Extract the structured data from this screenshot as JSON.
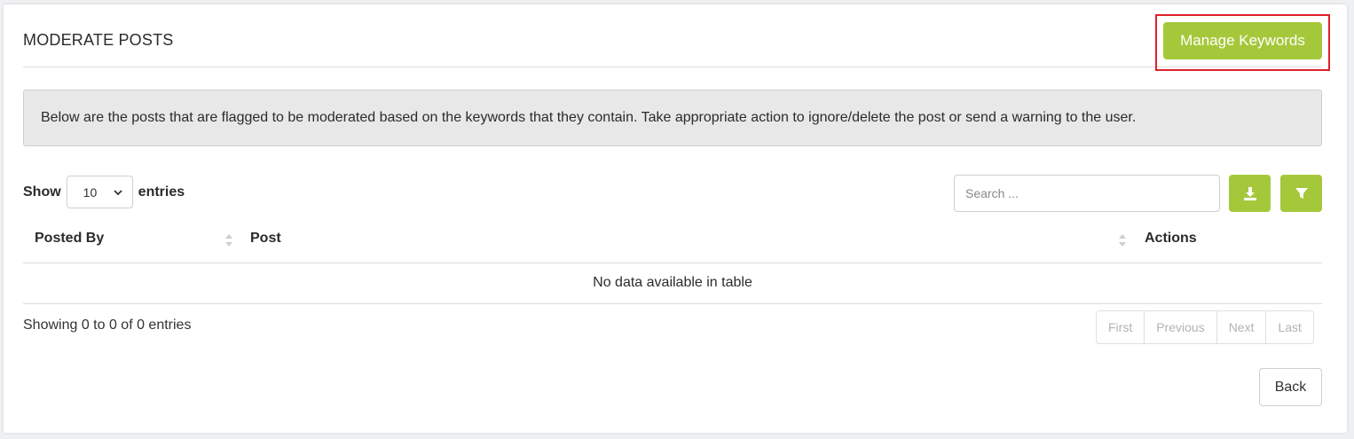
{
  "page": {
    "title": "MODERATE POSTS",
    "manage_keywords_label": "Manage Keywords",
    "notice": "Below are the posts that are flagged to be moderated based on the keywords that they contain. Take appropriate action to ignore/delete the post or send a warning to the user."
  },
  "table_controls": {
    "show_label": "Show",
    "entries_value": "10",
    "entries_label": "entries",
    "search_placeholder": "Search ...",
    "download_icon": "download-icon",
    "filter_icon": "filter-icon"
  },
  "table": {
    "columns": [
      "Posted By",
      "Post",
      "Actions"
    ],
    "empty_message": "No data available in table"
  },
  "footer": {
    "info": "Showing 0 to 0 of 0 entries",
    "pagination": [
      "First",
      "Previous",
      "Next",
      "Last"
    ],
    "back_label": "Back"
  },
  "colors": {
    "accent": "#a5c83a",
    "highlight": "#e0202a"
  }
}
